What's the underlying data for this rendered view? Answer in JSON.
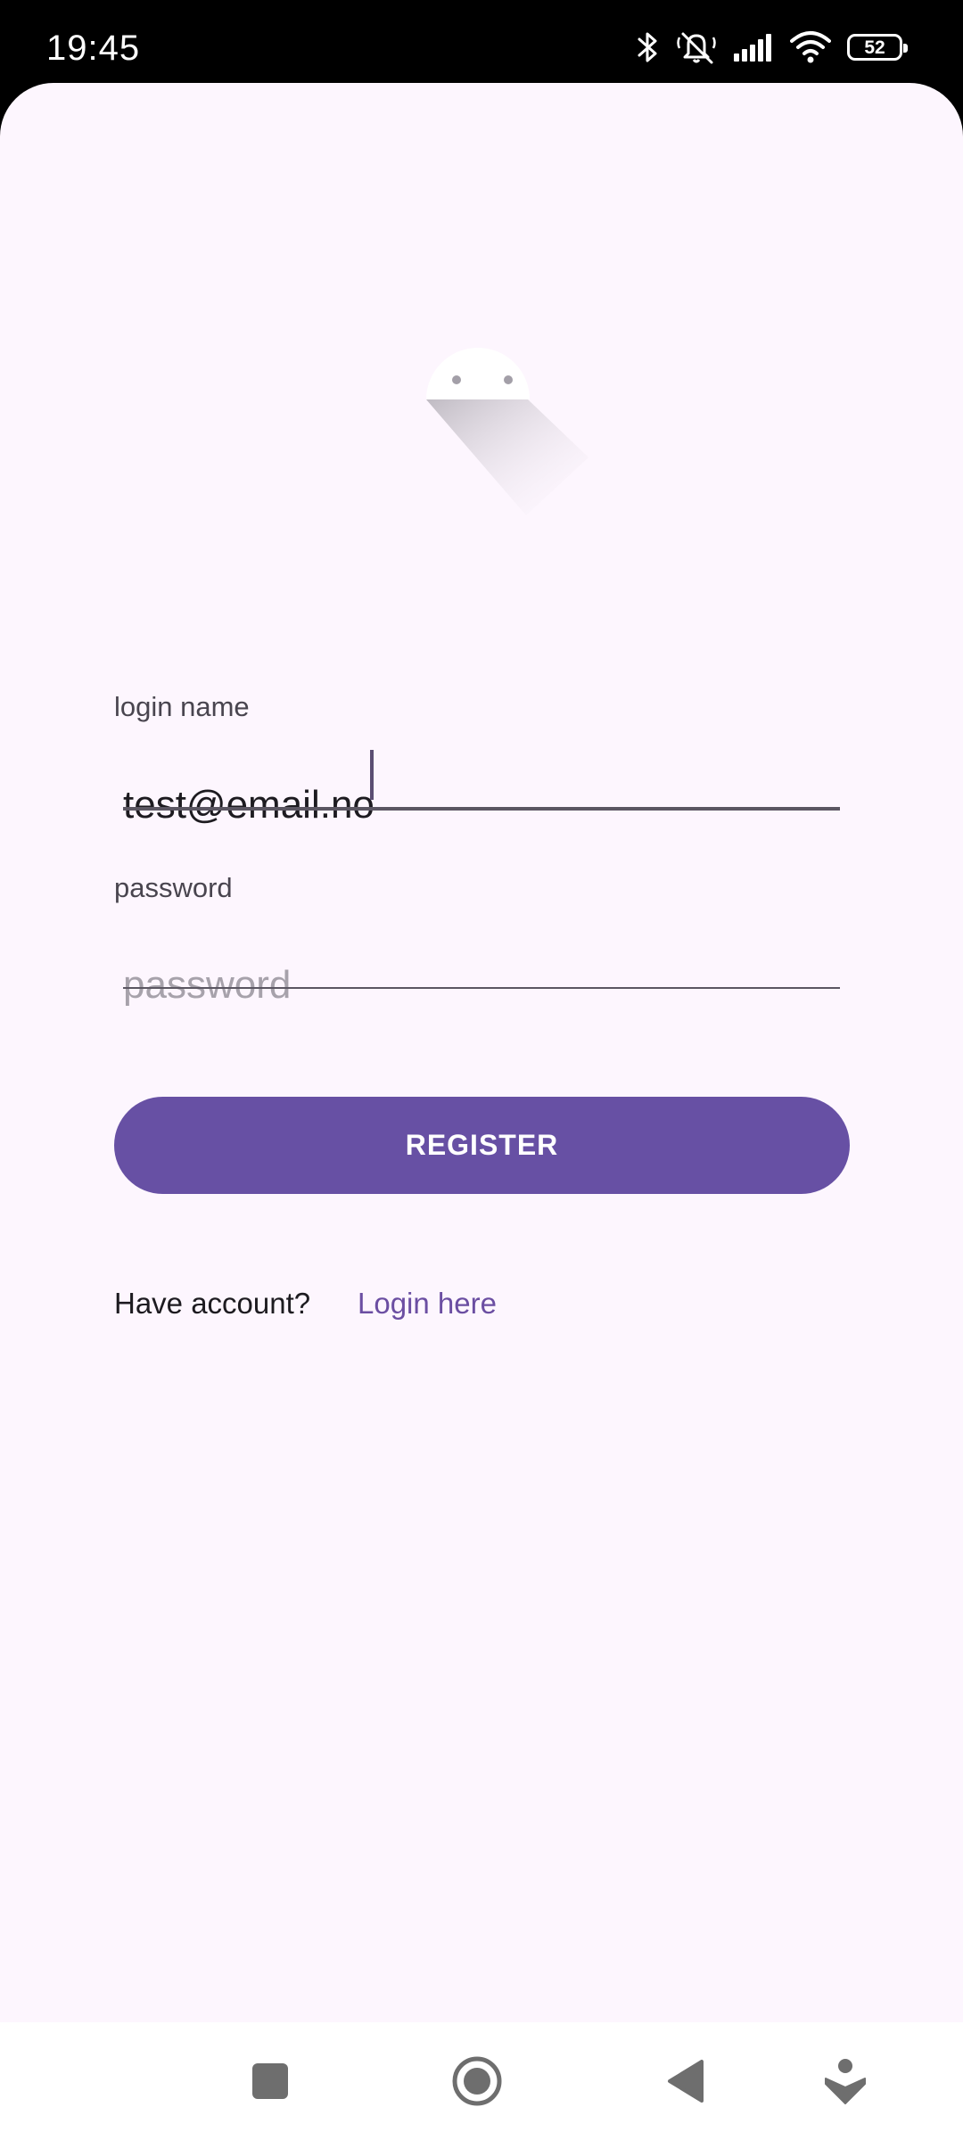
{
  "status_bar": {
    "time": "19:45",
    "battery_level": "52",
    "icons": [
      "bluetooth-icon",
      "silent-mode-icon",
      "cellular-signal-icon",
      "wifi-icon",
      "battery-icon"
    ]
  },
  "form": {
    "login_label": "login name",
    "login_value": "test@email.no",
    "password_label": "password",
    "password_placeholder": "password",
    "password_value": ""
  },
  "actions": {
    "register_label": "REGISTER",
    "have_account_text": "Have account?",
    "login_link_text": "Login here"
  },
  "nav_bar": {
    "buttons": [
      "recents-button",
      "home-button",
      "back-button",
      "assistant-button"
    ]
  },
  "colors": {
    "background": "#fdf6fe",
    "primary": "#6750a4",
    "link": "#6b4ea2",
    "text": "#1d1b20",
    "label": "#49454f"
  }
}
